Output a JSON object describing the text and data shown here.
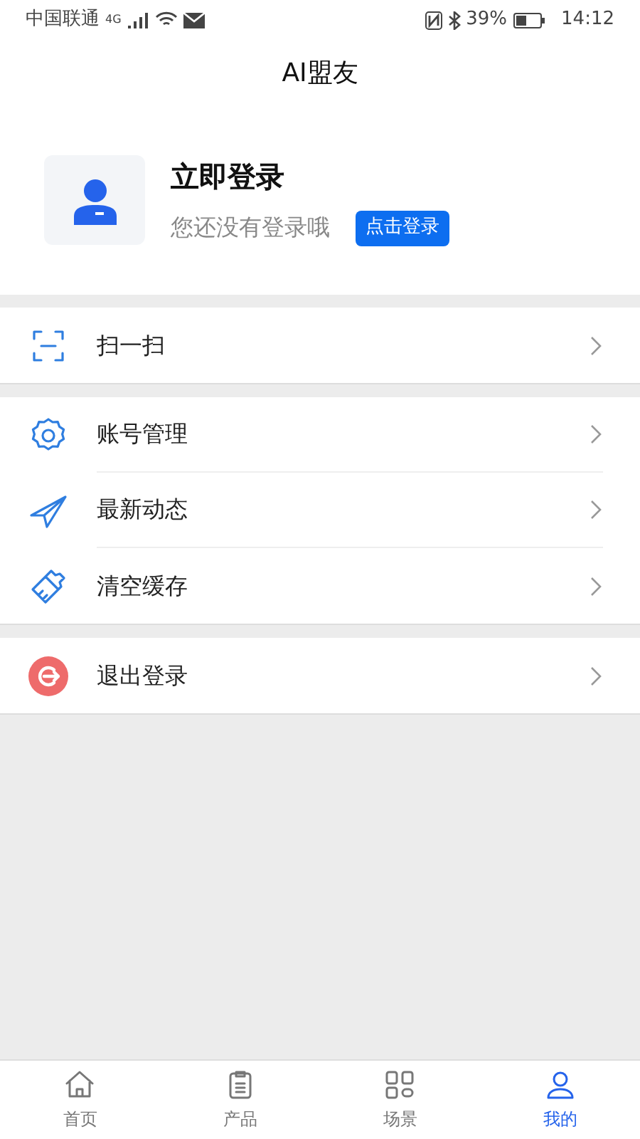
{
  "status_bar": {
    "carrier": "中国联通",
    "network": "4G",
    "battery": "39%",
    "time": "14:12"
  },
  "title": "AI盟友",
  "profile": {
    "name": "立即登录",
    "hint": "您还没有登录哦",
    "login_button": "点击登录"
  },
  "menu_groups": [
    {
      "items": [
        {
          "kind": "scan",
          "label": "扫一扫"
        }
      ]
    },
    {
      "items": [
        {
          "kind": "settings",
          "label": "账号管理"
        },
        {
          "kind": "news",
          "label": "最新动态"
        },
        {
          "kind": "clean",
          "label": "清空缓存"
        }
      ]
    },
    {
      "items": [
        {
          "kind": "logout",
          "label": "退出登录"
        }
      ]
    }
  ],
  "tabs": [
    {
      "kind": "home",
      "label": "首页",
      "selected": false
    },
    {
      "kind": "product",
      "label": "产品",
      "selected": false
    },
    {
      "kind": "scene",
      "label": "场景",
      "selected": false
    },
    {
      "kind": "mine",
      "label": "我的",
      "selected": true
    }
  ]
}
